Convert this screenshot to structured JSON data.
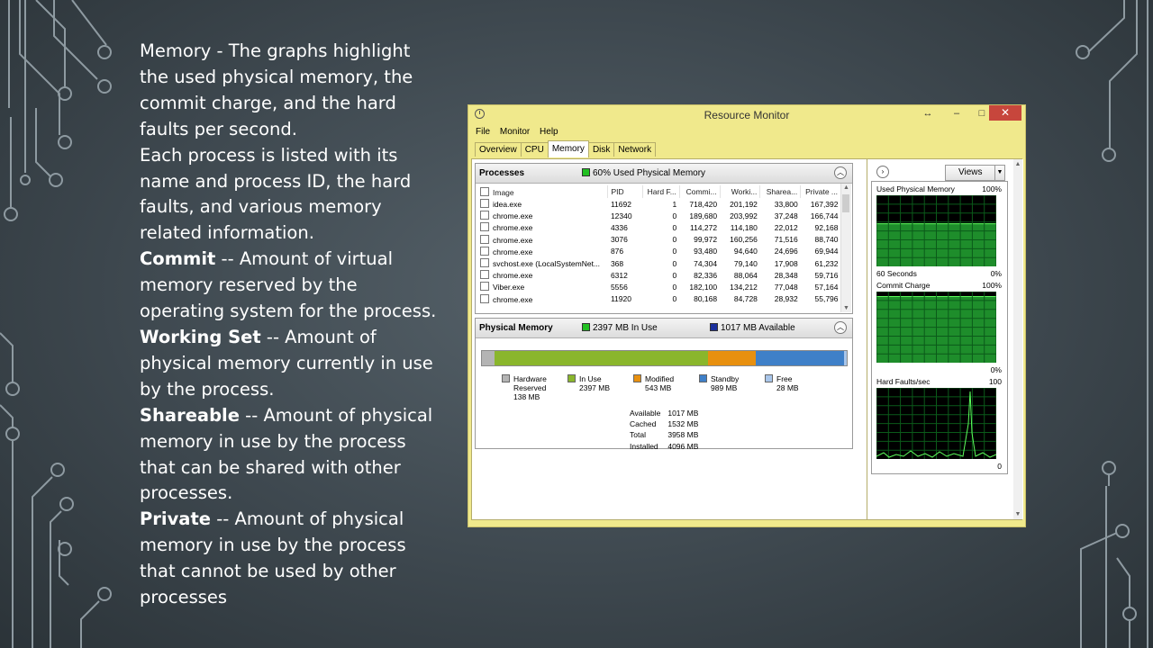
{
  "slide": {
    "intro1": "Memory - The graphs highlight the used physical memory, the commit charge, and the hard faults per second.",
    "intro2": "Each process is listed with its name and process ID, the hard faults, and various memory related information.",
    "terms": [
      {
        "term": "Commit",
        "desc": " -- Amount of virtual memory reserved by the operating system for the process."
      },
      {
        "term": "Working Set",
        "desc": " -- Amount of physical memory currently in use by the process."
      },
      {
        "term": "Shareable",
        "desc": " -- Amount of physical memory in use by the process that can be shared with other processes."
      },
      {
        "term": "Private",
        "desc": " -- Amount of physical memory in use by the process that cannot be used by other processes"
      }
    ]
  },
  "window": {
    "title": "Resource Monitor",
    "restore": "↔",
    "minimize": "–",
    "maximize": "□",
    "close": "✕",
    "menu": [
      "File",
      "Monitor",
      "Help"
    ],
    "tabs": [
      "Overview",
      "CPU",
      "Memory",
      "Disk",
      "Network"
    ],
    "active_tab": "Memory"
  },
  "processes": {
    "title": "Processes",
    "status": "60% Used Physical Memory",
    "status_color": "#22c022",
    "columns": [
      "Image",
      "PID",
      "Hard F...",
      "Commi...",
      "Worki...",
      "Sharea...",
      "Private ..."
    ],
    "rows": [
      [
        "idea.exe",
        "11692",
        "1",
        "718,420",
        "201,192",
        "33,800",
        "167,392"
      ],
      [
        "chrome.exe",
        "12340",
        "0",
        "189,680",
        "203,992",
        "37,248",
        "166,744"
      ],
      [
        "chrome.exe",
        "4336",
        "0",
        "114,272",
        "114,180",
        "22,012",
        "92,168"
      ],
      [
        "chrome.exe",
        "3076",
        "0",
        "99,972",
        "160,256",
        "71,516",
        "88,740"
      ],
      [
        "chrome.exe",
        "876",
        "0",
        "93,480",
        "94,640",
        "24,696",
        "69,944"
      ],
      [
        "svchost.exe (LocalSystemNet...",
        "368",
        "0",
        "74,304",
        "79,140",
        "17,908",
        "61,232"
      ],
      [
        "chrome.exe",
        "6312",
        "0",
        "82,336",
        "88,064",
        "28,348",
        "59,716"
      ],
      [
        "Viber.exe",
        "5556",
        "0",
        "182,100",
        "134,212",
        "77,048",
        "57,164"
      ],
      [
        "chrome.exe",
        "11920",
        "0",
        "80,168",
        "84,728",
        "28,932",
        "55,796"
      ]
    ]
  },
  "physical": {
    "title": "Physical Memory",
    "in_use_status": "2397 MB In Use",
    "in_use_color": "#22c022",
    "available_status": "1017 MB Available",
    "available_color": "#1a2f9c",
    "segments": [
      {
        "name": "Hardware Reserved",
        "mb": 138,
        "color": "#b4b4b4"
      },
      {
        "name": "In Use",
        "mb": 2397,
        "color": "#8ab62c"
      },
      {
        "name": "Modified",
        "mb": 543,
        "color": "#e8900f"
      },
      {
        "name": "Standby",
        "mb": 989,
        "color": "#3f80c8"
      },
      {
        "name": "Free",
        "mb": 28,
        "color": "#a9c6ea"
      }
    ],
    "legend": [
      {
        "label": "Hardware Reserved",
        "value": "138 MB",
        "color": "#b4b4b4"
      },
      {
        "label": "In Use",
        "value": "2397 MB",
        "color": "#8ab62c"
      },
      {
        "label": "Modified",
        "value": "543 MB",
        "color": "#e8900f"
      },
      {
        "label": "Standby",
        "value": "989 MB",
        "color": "#3f80c8"
      },
      {
        "label": "Free",
        "value": "28 MB",
        "color": "#a9c6ea"
      }
    ],
    "summary": [
      {
        "label": "Available",
        "value": "1017 MB"
      },
      {
        "label": "Cached",
        "value": "1532 MB"
      },
      {
        "label": "Total",
        "value": "3958 MB"
      },
      {
        "label": "Installed",
        "value": "4096 MB"
      }
    ]
  },
  "graphs": {
    "views_label": "Views",
    "used_physical": {
      "label": "Used Physical Memory",
      "max": "100%",
      "x_label": "60 Seconds",
      "min": "0%",
      "level": 0.6
    },
    "commit_charge": {
      "label": "Commit Charge",
      "max": "100%",
      "min": "0%",
      "level": 0.93
    },
    "hard_faults": {
      "label": "Hard Faults/sec",
      "max": "100",
      "min": "0"
    }
  }
}
